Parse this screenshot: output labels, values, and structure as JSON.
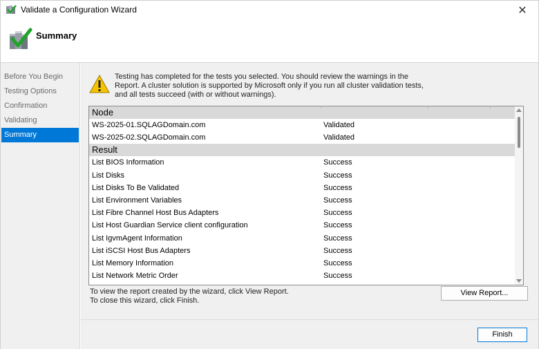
{
  "window": {
    "title": "Validate a Configuration Wizard",
    "close_glyph": "✕",
    "icon": "cluster-check-icon"
  },
  "header": {
    "heading": "Summary",
    "icon": "cluster-validate-icon"
  },
  "sidebar": {
    "items": [
      {
        "label": "Before You Begin",
        "active": false
      },
      {
        "label": "Testing Options",
        "active": false
      },
      {
        "label": "Confirmation",
        "active": false
      },
      {
        "label": "Validating",
        "active": false
      },
      {
        "label": "Summary",
        "active": true
      }
    ]
  },
  "message": {
    "icon": "warning-icon",
    "text": "Testing has completed for the tests you selected. You should review the warnings in the Report.  A cluster solution is supported by Microsoft only if you run all cluster validation tests, and all tests succeed (with or without warnings)."
  },
  "results": {
    "groups": [
      {
        "title": "Node",
        "rows": [
          {
            "name": "WS-2025-01.SQLAGDomain.com",
            "status": "Validated"
          },
          {
            "name": "WS-2025-02.SQLAGDomain.com",
            "status": "Validated"
          }
        ]
      },
      {
        "title": "Result",
        "rows": [
          {
            "name": "List BIOS Information",
            "status": "Success"
          },
          {
            "name": "List Disks",
            "status": "Success"
          },
          {
            "name": "List Disks To Be Validated",
            "status": "Success"
          },
          {
            "name": "List Environment Variables",
            "status": "Success"
          },
          {
            "name": "List Fibre Channel Host Bus Adapters",
            "status": "Success"
          },
          {
            "name": "List Host Guardian Service client configuration",
            "status": "Success"
          },
          {
            "name": "List IgvmAgent Information",
            "status": "Success"
          },
          {
            "name": "List iSCSI Host Bus Adapters",
            "status": "Success"
          },
          {
            "name": "List Memory Information",
            "status": "Success"
          },
          {
            "name": "List Network Metric Order",
            "status": "Success"
          }
        ]
      }
    ]
  },
  "hints": {
    "view_report": "To view the report created by the wizard, click View Report.",
    "finish": "To close this wizard, click Finish."
  },
  "buttons": {
    "view_report": "View Report...",
    "finish": "Finish"
  },
  "colors": {
    "selection": "#0078d7",
    "group_header": "#d9d9d9",
    "check_green": "#1fa32a",
    "warning_yellow": "#f5c400"
  }
}
